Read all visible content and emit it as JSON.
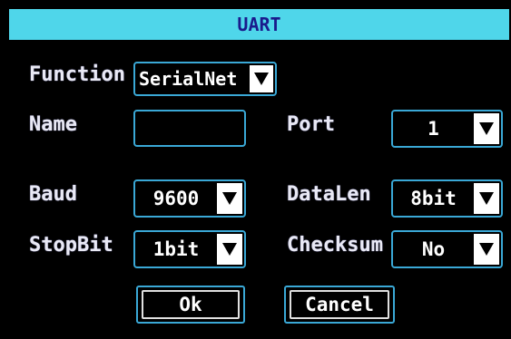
{
  "dialog": {
    "title": "UART"
  },
  "fields": {
    "function": {
      "label": "Function",
      "value": "SerialNet"
    },
    "name": {
      "label": "Name",
      "value": ""
    },
    "port": {
      "label": "Port",
      "value": "1"
    },
    "baud": {
      "label": "Baud",
      "value": "9600"
    },
    "datalen": {
      "label": "DataLen",
      "value": "8bit"
    },
    "stopbit": {
      "label": "StopBit",
      "value": "1bit"
    },
    "checksum": {
      "label": "Checksum",
      "value": "No"
    }
  },
  "buttons": {
    "ok": "Ok",
    "cancel": "Cancel"
  },
  "icons": {
    "dropdown": "triangle-down-icon"
  },
  "colors": {
    "title_bar": "#4fd6ea",
    "title_text": "#1a1a8c",
    "border": "#3aa8d6",
    "background": "#000000"
  }
}
